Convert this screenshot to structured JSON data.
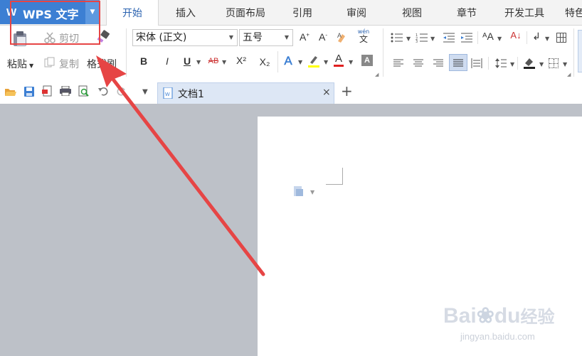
{
  "app": {
    "title": "WPS 文字",
    "logo_glyph": "W"
  },
  "tabs": [
    "开始",
    "插入",
    "页面布局",
    "引用",
    "审阅",
    "视图",
    "章节",
    "开发工具",
    "特色"
  ],
  "active_tab": "开始",
  "clipboard": {
    "cut": "剪切",
    "paste": "粘贴",
    "copy": "复制",
    "format_painter": "格式刷"
  },
  "font": {
    "name": "宋体 (正文)",
    "size": "五号"
  },
  "font_buttons": {
    "bold": "B",
    "italic": "I",
    "underline": "U",
    "strike": "AB",
    "superscript": "X²",
    "subscript": "X₂",
    "grow": "A",
    "shrink": "A",
    "phonetic": "wén"
  },
  "document": {
    "tab_title": "文档1",
    "close_glyph": "×",
    "new_tab_glyph": "+"
  },
  "watermark": {
    "brand": "Bai",
    "brand_mid": "du",
    "brand_cn": "经验",
    "url": "jingyan.baidu.com"
  },
  "colors": {
    "accent": "#3c7fd3",
    "annotation": "#e64545",
    "highlight": "#ffff00",
    "font_color": "#e02020"
  }
}
